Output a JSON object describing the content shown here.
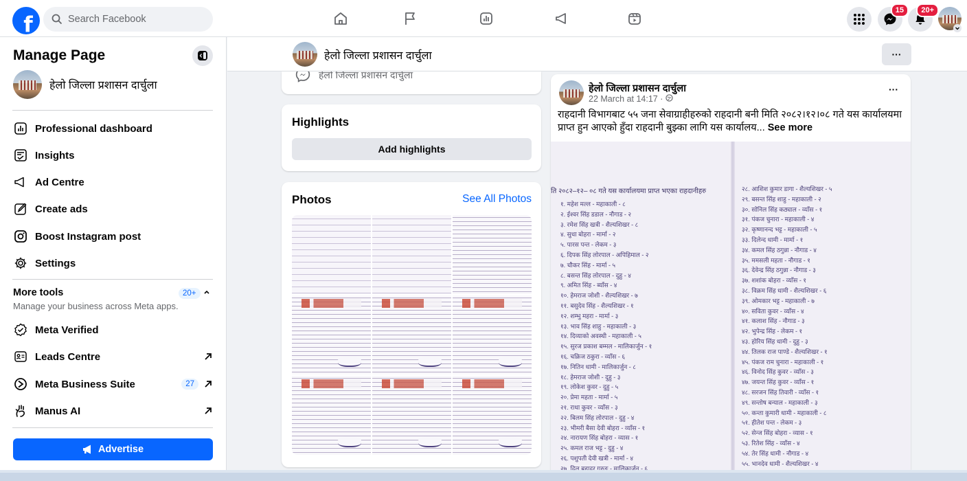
{
  "colors": {
    "brand": "#0866ff",
    "badge": "#e41e3f"
  },
  "topbar": {
    "logo_letter": "f",
    "search_placeholder": "Search Facebook",
    "nav_icons": [
      "home-icon",
      "flag-icon",
      "dashboard-icon",
      "megaphone-icon",
      "video-icon"
    ],
    "messenger_badge": "15",
    "notifications_badge": "20+"
  },
  "sidebar": {
    "title": "Manage Page",
    "page_name": "हेलो जिल्ला प्रशासन दार्चुला",
    "items": [
      {
        "label": "Professional dashboard",
        "icon": "dashboard-icon"
      },
      {
        "label": "Insights",
        "icon": "insights-icon"
      },
      {
        "label": "Ad Centre",
        "icon": "megaphone-icon"
      },
      {
        "label": "Create ads",
        "icon": "pencil-icon"
      },
      {
        "label": "Boost Instagram post",
        "icon": "instagram-icon"
      },
      {
        "label": "Settings",
        "icon": "gear-icon"
      }
    ],
    "more_tools": {
      "title": "More tools",
      "subtitle": "Manage your business across Meta apps.",
      "badge": "20+"
    },
    "tools": [
      {
        "label": "Meta Verified",
        "icon": "verified-icon"
      },
      {
        "label": "Leads Centre",
        "icon": "leads-icon",
        "external": true
      },
      {
        "label": "Meta Business Suite",
        "icon": "business-suite-icon",
        "count": "27",
        "external": true
      },
      {
        "label": "Manus AI",
        "icon": "manus-icon",
        "external": true
      }
    ],
    "advertise": "Advertise"
  },
  "header": {
    "page_name": "हेलो जिल्ला प्रशासन दार्चुला",
    "more": "···"
  },
  "intro": {
    "faded_text": "हेलो जिल्ला प्रशासन दार्चुला"
  },
  "highlights": {
    "title": "Highlights",
    "button": "Add highlights"
  },
  "photos": {
    "title": "Photos",
    "see_all": "See All Photos"
  },
  "post": {
    "author": "हेलो जिल्ला प्रशासन दार्चुला",
    "time": "22 March at 14:17 · ",
    "text": "राहदानी विभागबाट ५५ जना सेवाग्राहीहरुको राहदानी बनी मिति २०८२।१२।०८ गते यस कार्यालयमा प्राप्त हुन आएको हुँदा राहदानी बुझ्का लागि यस कार्यालय...",
    "see_more": "See more",
    "image": {
      "heading": "ति २०८२–१२– ०८ गते यस कार्यालयमा प्राप्त भएका राहदानीहरु",
      "col_a": [
        "१. महेश मल्ल - महाकाली - ८",
        "२. ईश्वर सिंह डडाल - नौगाड - २",
        "३. रमेश सिंह खत्री - शैल्यशिखर - ८",
        "४. सुधा बोहरा - मार्मा - २",
        "५. पारस पन्त - लेकम - ३",
        "६. दिपक सिंह लोरपाल - अपिहिमाल - २",
        "७. चौकर सिंह - मार्मा - ५",
        "८. बसन्त सिंह लोरपाल - दुहु - ४",
        "९. अमित सिंह - ब्याँस - ४",
        "१०. हेमराज जोशी - शैल्यशिखर - ७",
        "११. बसुदेव सिंह - शैल्यशिखर - १",
        "१२. शम्भु महरा - मार्मा - ३",
        "१३. भाव सिंह शाहु - महाकाली - ३",
        "१४. दिव्याको अवस्थी - महाकाली - ५",
        "१५. सुरज प्रकाश बम्मल - मालिकार्जुन - १",
        "१६. चक्रिज ठकुरा - व्याँस - ६",
        "१७. नितिन धामी - मालिकार्जुन - ८",
        "१८. हेमराज जोशी - दुहु - ३",
        "१९. लोकेश कुवर - दुहु - ५",
        "२०. प्रेमा महता - मार्मा - ५",
        "२१. राधा कुवर - व्याँस - ३",
        "२२. बिलम सिंह लोरपाल - दुहु - ४",
        "२३. भीमरी बैसा देवी बोहरा - व्याँस - १",
        "२४. नारायण सिंह बोहरा - व्यास - १",
        "२५. कमल राज भट्ट - दुहु - ४",
        "२६. पशुपती देवी खत्री - मार्मा - ४",
        "२७. दिल बहादुर गुरुङ - मालिकार्जुन - ६"
      ],
      "col_b": [
        "२८. आशिश कुमार डागा - शैल्यशिखर - ५",
        "२९. बसन्त सिंह शाहु - महाकाली - २",
        "३०. सोनिल सिंह कठ्याल - व्याँस - १",
        "३१. पंकज चुनारा - महाकाली - ४",
        "३२. कृष्णानन्द भट्ट - महाकाली - ५",
        "३३. दिलेन्द धामी - मार्मा - १",
        "३४. कमल सिंह ठगुन्ना - नौगाड - ४",
        "३५. ममसली महता - नौगाड - १",
        "३६. देवेन्द्र सिंह ठगुन्ना - नौगाड - ३",
        "३७. शशांक बोहरा - व्याँस - १",
        "३८. विक्रम सिंह धामी - शैल्यशिखर - ६",
        "३९. ओमकार भट्ट - महाकाली - ७",
        "४०. सविता कुवर - व्याँस - ४",
        "४१. कलाश सिंह - नौगाड - ३",
        "४२. भुपेन्द्र सिंह - लेकम - १",
        "४३. होरिय सिंह धामी - दुहु - ३",
        "४४. तिलक राज पाण्डे - शैल्यशिखर - १",
        "४५. पंकज राम चुनारा - महाकाली - १",
        "४६. विनोद सिंह कुवर - व्याँस - ३",
        "४७. जयन्त सिंह कुवर - व्याँस - १",
        "४८. सरजन सिंह तिवारी - व्याँस - १",
        "४९. सन्तोष बन्याल - महाकाली - ३",
        "५०. कन्ता कुमारी धामी - महाकाली - ८",
        "५१. हीतेश पन्त - लेकम - ३",
        "५२. सेन्ज सिंह बोहरा - व्यास - १",
        "५३. रितेश सिंह - व्याँस - ४",
        "५४. तेर सिंह धामी - नौगाड - ४",
        "५५. भानदेव धामी - शैल्यशिखर - ४"
      ]
    }
  }
}
